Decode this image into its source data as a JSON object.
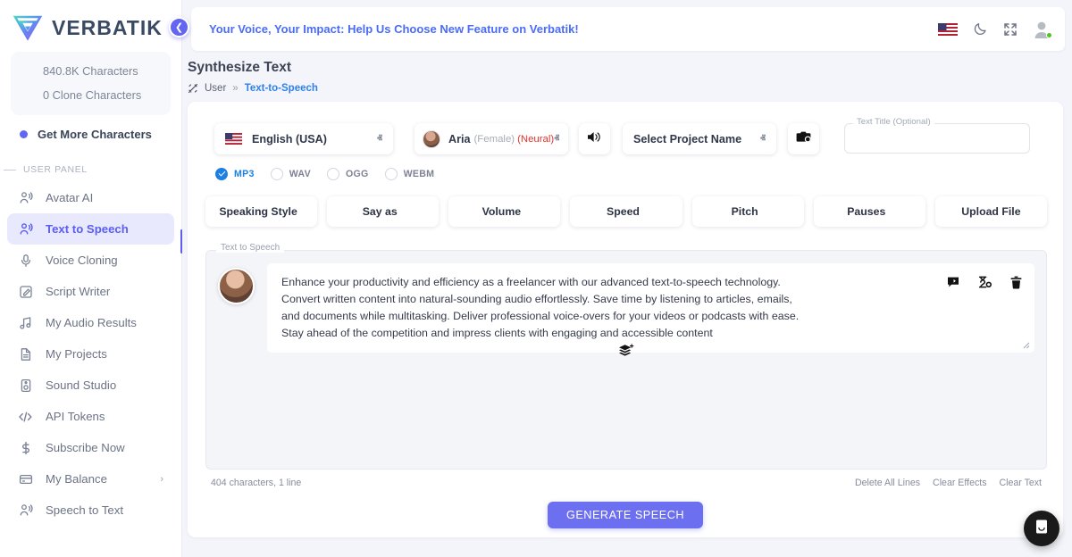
{
  "brand": {
    "name": "VERBATIK",
    "logo_icon": "verbatik-triangle-logo",
    "collapse_icon": "chevron-left-icon"
  },
  "sidebar": {
    "characters": "840.8K Characters",
    "clone_characters": "0 Clone Characters",
    "get_more": "Get More Characters",
    "panel_label": "USER PANEL",
    "items": [
      {
        "label": "Avatar AI",
        "icon": "person-speaking-icon",
        "active": false,
        "chevron": ""
      },
      {
        "label": "Text to Speech",
        "icon": "person-speaking-icon",
        "active": true,
        "chevron": ""
      },
      {
        "label": "Voice Cloning",
        "icon": "microphone-icon",
        "active": false,
        "chevron": ""
      },
      {
        "label": "Script Writer",
        "icon": "pencil-square-icon",
        "active": false,
        "chevron": ""
      },
      {
        "label": "My Audio Results",
        "icon": "music-note-icon",
        "active": false,
        "chevron": ""
      },
      {
        "label": "My Projects",
        "icon": "document-icon",
        "active": false,
        "chevron": ""
      },
      {
        "label": "Sound Studio",
        "icon": "speaker-box-icon",
        "active": false,
        "chevron": ""
      },
      {
        "label": "API Tokens",
        "icon": "code-brackets-icon",
        "active": false,
        "chevron": ""
      },
      {
        "label": "Subscribe Now",
        "icon": "dollar-sign-icon",
        "active": false,
        "chevron": ""
      },
      {
        "label": "My Balance",
        "icon": "credit-card-icon",
        "active": false,
        "chevron": "›"
      },
      {
        "label": "Speech to Text",
        "icon": "person-speaking-icon",
        "active": false,
        "chevron": ""
      }
    ]
  },
  "topbar": {
    "promo": "Your Voice, Your Impact: Help Us Choose New Feature on Verbatik!",
    "icons": [
      "us-flag-icon",
      "moon-dark-mode-icon",
      "fullscreen-expand-icon",
      "user-avatar-icon"
    ],
    "status": "online"
  },
  "page": {
    "title": "Synthesize Text",
    "breadcrumb": {
      "icon": "link-slash-icon",
      "root": "User",
      "separator": "»",
      "current": "Text-to-Speech"
    }
  },
  "controls": {
    "language": {
      "value": "English (USA)",
      "flag": "us-flag-icon",
      "caret": "ⱏ"
    },
    "voice": {
      "name": "Aria",
      "gender": "(Female)",
      "type": "(Neural)",
      "caret": "ⱏ"
    },
    "preview_icon": "speaker-volume-icon",
    "project": {
      "value": "Select Project Name",
      "caret": "ⱏ"
    },
    "project_icon": "camera-project-icon",
    "text_title": {
      "label": "Text Title (Optional)",
      "value": "",
      "placeholder": ""
    },
    "formats": [
      {
        "label": "MP3",
        "selected": true
      },
      {
        "label": "WAV",
        "selected": false
      },
      {
        "label": "OGG",
        "selected": false
      },
      {
        "label": "WEBM",
        "selected": false
      }
    ]
  },
  "tools": [
    {
      "label": "Speaking Style",
      "caret": "ⱟ"
    },
    {
      "label": "Say as",
      "caret": "ⱟ"
    },
    {
      "label": "Volume",
      "caret": "ⱟ"
    },
    {
      "label": "Speed",
      "caret": "ⱟ"
    },
    {
      "label": "Pitch",
      "caret": "ⱟ"
    },
    {
      "label": "Pauses",
      "caret": "ⱟ"
    },
    {
      "label": "Upload File",
      "caret": ""
    }
  ],
  "editor": {
    "label": "Text to Speech",
    "avatar_icon": "voice-avatar-icon",
    "text": "Enhance your productivity and efficiency as a freelancer with our advanced text-to-speech technology. Convert written content into natural-sounding audio effortlessly. Save time by listening to articles, emails, and documents while multitasking. Deliver professional voice-overs for your videos or podcasts with ease. Stay ahead of the competition and impress clients with engaging and accessible content",
    "line_icons": [
      "comment-effect-icon",
      "clear-effects-icon",
      "trash-delete-icon"
    ],
    "add_line_icon": "add-layer-icon",
    "char_count": "404 characters, 1 line",
    "links": [
      "Delete All Lines",
      "Clear Effects",
      "Clear Text"
    ]
  },
  "generate_button": "GENERATE SPEECH",
  "chat_widget": {
    "icon": "chat-bubble-icon"
  },
  "colors": {
    "accent": "#6366f1",
    "link": "#4a6cf7",
    "breadcrumb": "#2f80ed",
    "radio_selected": "#1b7fe3",
    "neural_tag": "#e0342c",
    "status": "#52c41a",
    "page_bg": "#f4f5fa"
  }
}
